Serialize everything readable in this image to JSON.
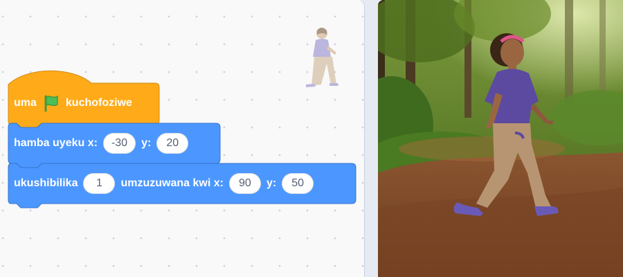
{
  "blocks": {
    "hat": {
      "label_before": "uma",
      "flag_icon": "green-flag-icon",
      "label_after": "kuchofoziwe",
      "color": "#ffab19"
    },
    "goto": {
      "label": "hamba uyeku x:",
      "x": "-30",
      "y_label": "y:",
      "y": "20",
      "color": "#4c97ff"
    },
    "glide": {
      "label": "ukushibilika",
      "secs": "1",
      "mid_label": "umzuzuwana kwi x:",
      "x": "90",
      "y_label": "y:",
      "y": "50",
      "color": "#4c97ff"
    }
  },
  "stage": {
    "backdrop": "forest-path",
    "sprite": "walking-girl"
  }
}
